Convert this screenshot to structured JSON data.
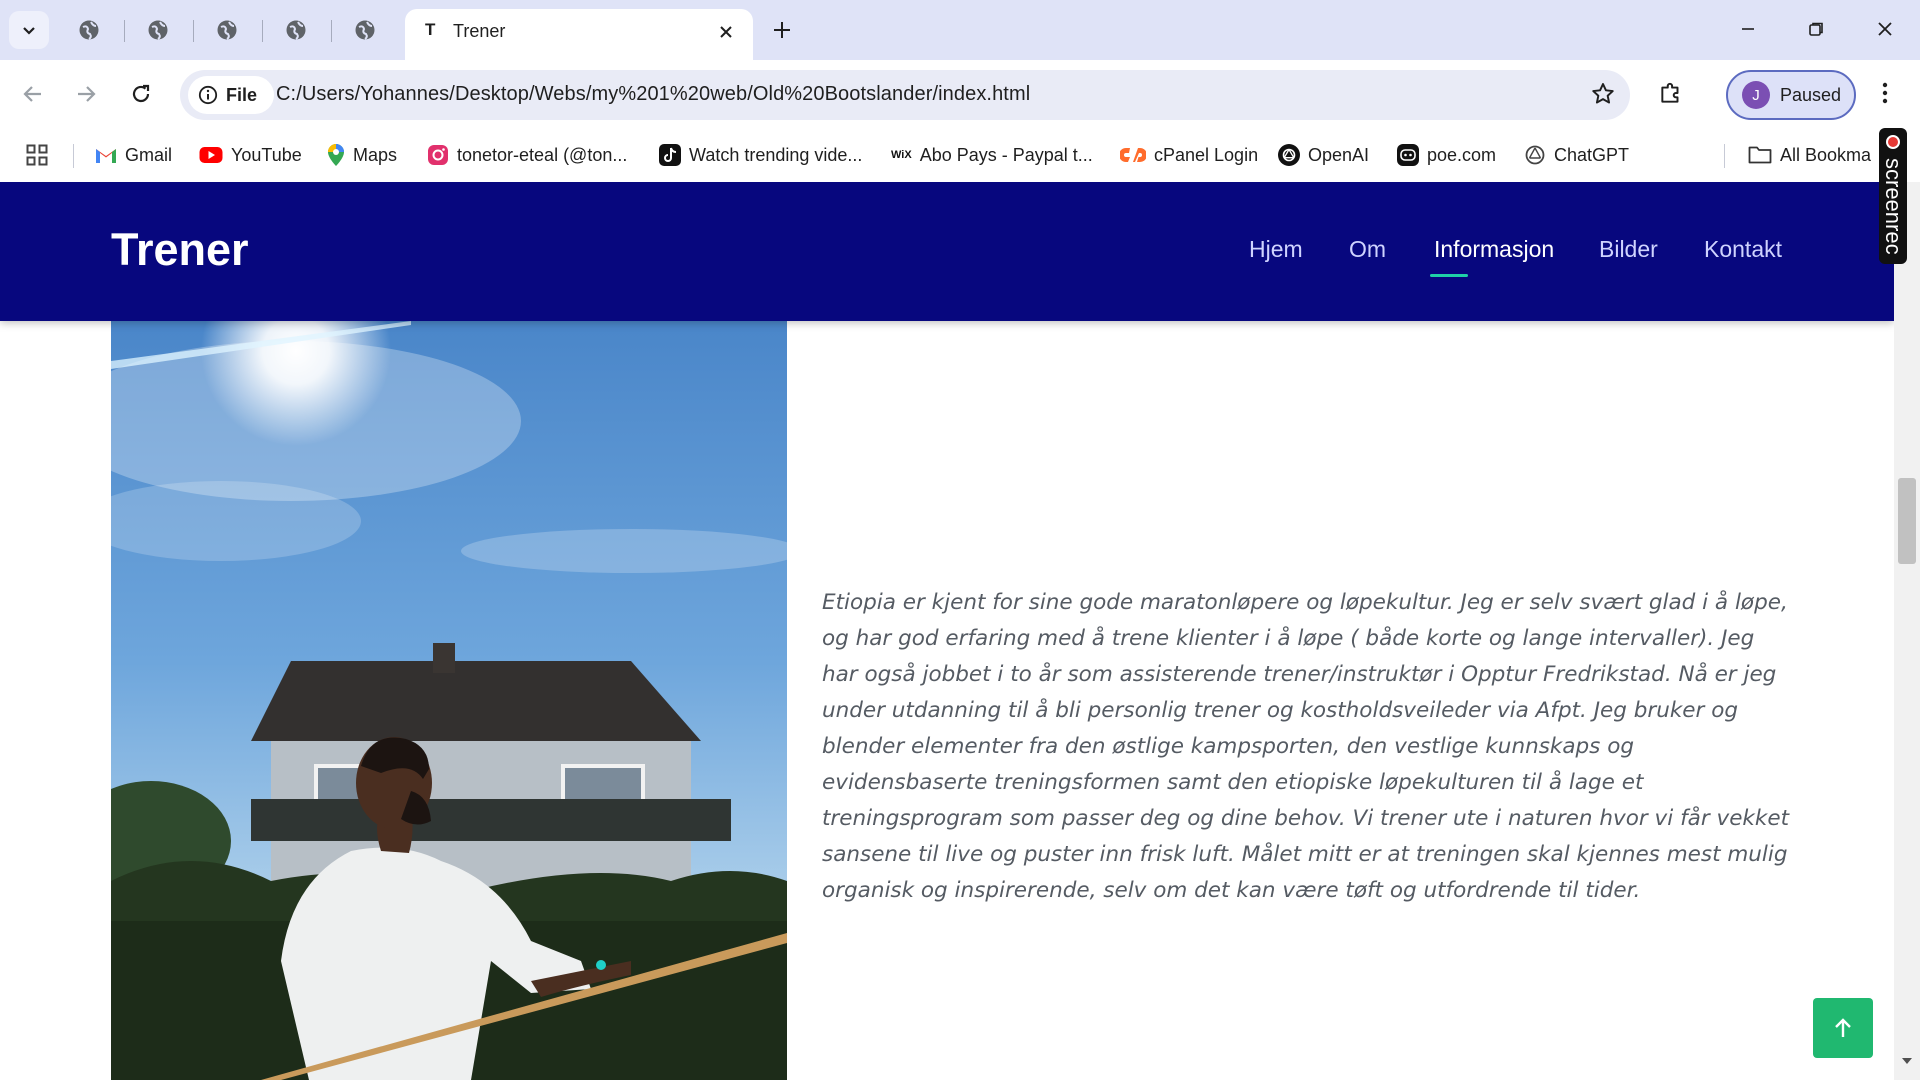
{
  "browser": {
    "active_tab_title": "Trener",
    "active_tab_favicon": "T",
    "url_chip_label": "File",
    "url": "C:/Users/Yohannes/Desktop/Webs/my%201%20web/Old%20Bootslander/index.html",
    "profile_initial": "J",
    "profile_status": "Paused",
    "bookmarks": [
      {
        "label": "Gmail",
        "icon": "gmail-icon"
      },
      {
        "label": "YouTube",
        "icon": "youtube-icon"
      },
      {
        "label": "Maps",
        "icon": "maps-icon"
      },
      {
        "label": "tonetor-eteal (@ton...",
        "icon": "instagram-icon"
      },
      {
        "label": "Watch trending vide...",
        "icon": "tiktok-icon"
      },
      {
        "label": "Abo Pays - Paypal t...",
        "icon": "wix-icon"
      },
      {
        "label": "cPanel Login",
        "icon": "cpanel-icon"
      },
      {
        "label": "OpenAI",
        "icon": "openai-icon"
      },
      {
        "label": "poe.com",
        "icon": "poe-icon"
      },
      {
        "label": "ChatGPT",
        "icon": "chatgpt-icon"
      }
    ],
    "all_bookmarks_label": "All Bookma",
    "recorder_label": "screenrec"
  },
  "site": {
    "logo": "Trener",
    "nav": [
      "Hjem",
      "Om",
      "Informasjon",
      "Bilder",
      "Kontakt"
    ],
    "active_nav": "Informasjon",
    "bio": "Etiopia er kjent for sine gode maratonløpere og løpekultur. Jeg er selv svært glad i å løpe, og har god erfaring med å trene klienter i å løpe ( både korte og lange intervaller). Jeg har også jobbet i to år som assisterende trener/instruktør i Opptur Fredrikstad. Nå er jeg under utdanning til å bli personlig trener og kostholdsveileder via Afpt. Jeg bruker og blender elementer fra den østlige kampsporten, den vestlige kunnskaps og evidensbaserte treningsformen samt den etiopiske løpekulturen til å lage et treningsprogram som passer deg og dine behov. Vi trener ute i naturen hvor vi får vekket sansene til live og puster inn frisk luft. Målet mitt er at treningen skal kjennes mest mulig organisk og inspirerende, selv om det kan være tøft og utfordrende til tider."
  },
  "colors": {
    "header_bg": "#07077e",
    "active_underline": "#1fd0a8",
    "back_to_top_bg": "#20b870"
  }
}
